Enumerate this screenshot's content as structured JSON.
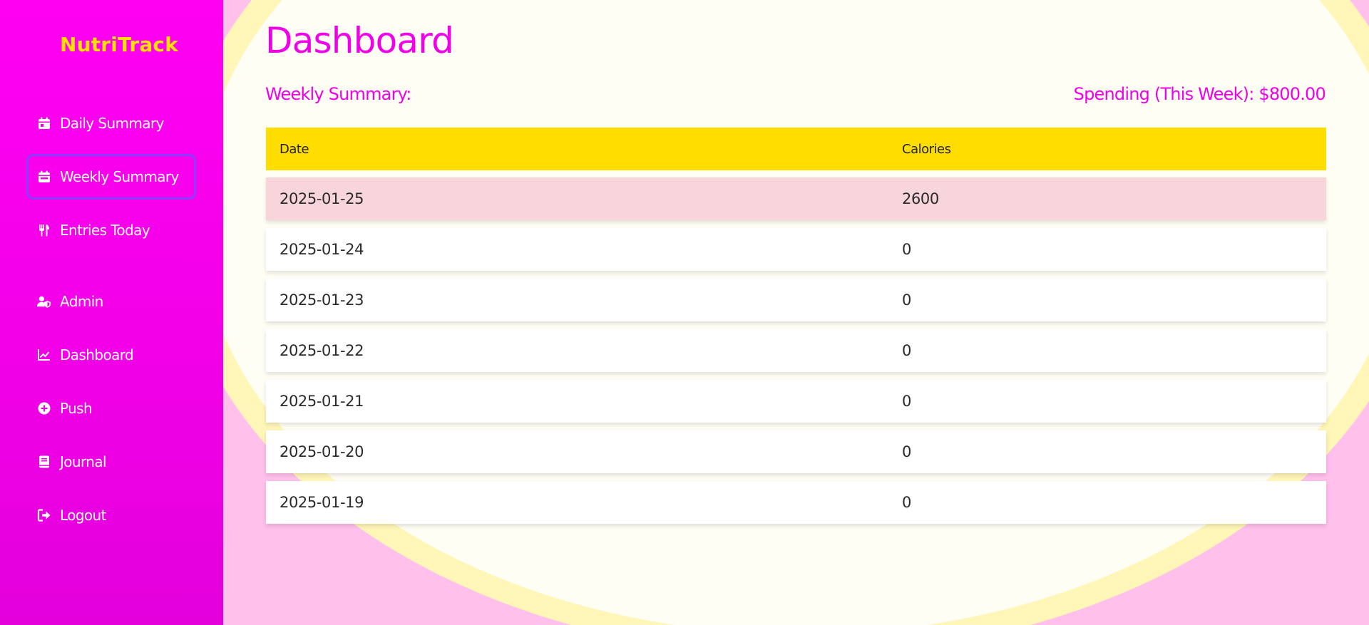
{
  "app": {
    "brand": "NutriTrack"
  },
  "sidebar": {
    "items": [
      {
        "label": "Daily Summary",
        "icon": "calendar-day-icon",
        "active": false
      },
      {
        "label": "Weekly Summary",
        "icon": "calendar-week-icon",
        "active": true
      },
      {
        "label": "Entries Today",
        "icon": "utensils-icon",
        "active": false
      },
      {
        "label": "Admin",
        "icon": "user-shield-icon",
        "active": false
      },
      {
        "label": "Dashboard",
        "icon": "chart-line-icon",
        "active": false
      },
      {
        "label": "Push",
        "icon": "plus-circle-icon",
        "active": false
      },
      {
        "label": "Journal",
        "icon": "book-icon",
        "active": false
      },
      {
        "label": "Logout",
        "icon": "sign-out-icon",
        "active": false
      }
    ]
  },
  "main": {
    "title": "Dashboard",
    "weekly_heading": "Weekly Summary:",
    "spending": "Spending (This Week): $800.00",
    "table": {
      "headers": [
        "Date",
        "Calories"
      ],
      "rows": [
        {
          "date": "2025-01-25",
          "calories": "2600",
          "highlight": true
        },
        {
          "date": "2025-01-24",
          "calories": "0"
        },
        {
          "date": "2025-01-23",
          "calories": "0"
        },
        {
          "date": "2025-01-22",
          "calories": "0"
        },
        {
          "date": "2025-01-21",
          "calories": "0"
        },
        {
          "date": "2025-01-20",
          "calories": "0"
        },
        {
          "date": "2025-01-19",
          "calories": "0"
        }
      ]
    }
  },
  "colors": {
    "sidebar_bg": "#ff00f2",
    "brand": "#ffe000",
    "accent_magenta": "#f000e8",
    "table_header": "#ffdd00",
    "highlight_row": "#f7d5da",
    "active_border": "#8a3cff",
    "page_bg": "#fffef5",
    "deco_pink": "#ffc0ec",
    "deco_yellow": "#fff6b8"
  }
}
